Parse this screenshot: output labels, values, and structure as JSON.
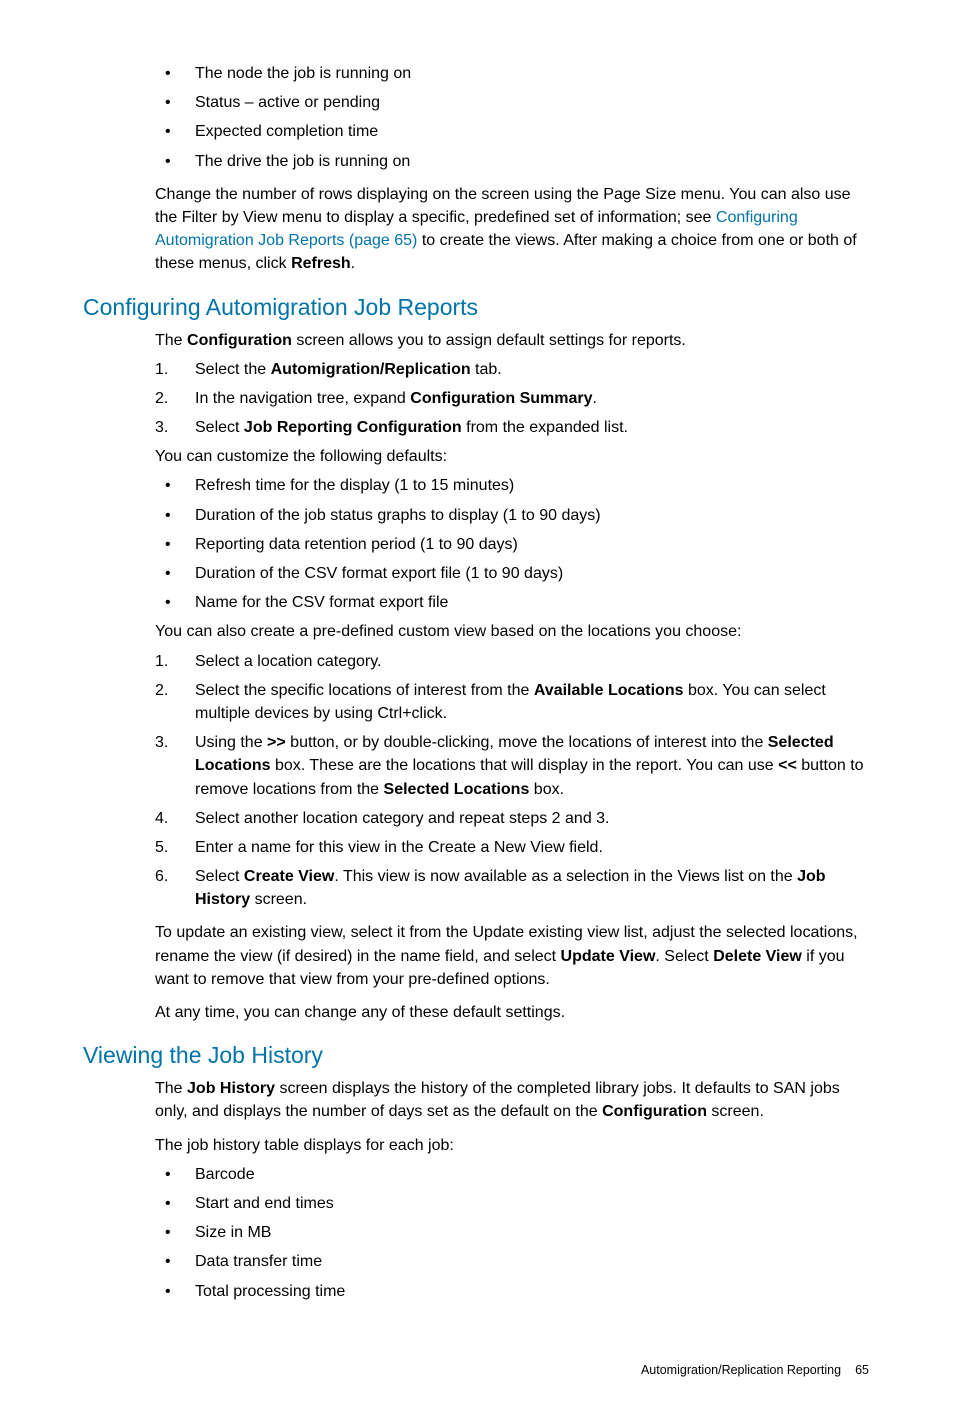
{
  "top_bullets": [
    "The node the job is running on",
    "Status – active or pending",
    "Expected completion time",
    "The drive the job is running on"
  ],
  "top_para": {
    "pre": "Change the number of rows displaying on the screen using the Page Size menu. You can also use the Filter by View menu to display a specific, predefined set of information; see ",
    "link": "Configuring Automigration Job Reports (page 65)",
    "post": " to create the views. After making a choice from one or both of these menus, click ",
    "bold_refresh": "Refresh",
    "period": "."
  },
  "sec1": {
    "heading": "Configuring Automigration Job Reports",
    "intro_pre": "The ",
    "intro_bold": "Configuration",
    "intro_post": " screen allows you to assign default settings for reports.",
    "steps1": {
      "s1_pre": "Select the ",
      "s1_bold": "Automigration/Replication",
      "s1_post": " tab.",
      "s2_pre": "In the navigation tree, expand ",
      "s2_bold": "Configuration Summary",
      "s2_post": ".",
      "s3_pre": "Select ",
      "s3_bold": "Job Reporting Configuration",
      "s3_post": " from the expanded list."
    },
    "customize_intro": "You can customize the following defaults:",
    "customize_bullets": [
      "Refresh time for the display (1 to 15 minutes)",
      "Duration of the job status graphs to display (1 to 90 days)",
      "Reporting data retention period (1 to 90 days)",
      "Duration of the CSV format export file (1 to 90 days)",
      "Name for the CSV format export file"
    ],
    "predefined_intro": "You can also create a pre-defined custom view based on the locations you choose:",
    "steps2": {
      "s1": "Select a location category.",
      "s2_pre": "Select the specific locations of interest from the ",
      "s2_bold": "Available Locations",
      "s2_post": " box. You can select multiple devices by using Ctrl+click.",
      "s3_pre": "Using the ",
      "s3_bold1": ">>",
      "s3_mid1": " button, or by double-clicking, move the locations of interest into the ",
      "s3_bold2": "Selected Locations",
      "s3_mid2": " box. These are the locations that will display in the report. You can use ",
      "s3_bold3": "<<",
      "s3_mid3": " button to remove locations from the ",
      "s3_bold4": "Selected Locations",
      "s3_post": " box.",
      "s4": "Select another location category and repeat steps 2 and 3.",
      "s5": "Enter a name for this view in the Create a New View field.",
      "s6_pre": "Select ",
      "s6_bold1": "Create View",
      "s6_mid": ". This view is now available as a selection in the Views list on the ",
      "s6_bold2": "Job History",
      "s6_post": " screen."
    },
    "update_para_pre": "To update an existing view, select it from the Update existing view list, adjust the selected locations, rename the view (if desired) in the name field, and select ",
    "update_bold1": "Update View",
    "update_mid": ". Select ",
    "update_bold2": "Delete View",
    "update_post": " if you want to remove that view from your pre-defined options.",
    "anytime": "At any time, you can change any of these default settings."
  },
  "sec2": {
    "heading": "Viewing the Job History",
    "intro_pre": "The ",
    "intro_bold1": "Job History",
    "intro_mid": " screen displays the history of the completed library jobs. It defaults to SAN jobs only, and displays the number of days set as the default on the ",
    "intro_bold2": "Configuration",
    "intro_post": " screen.",
    "table_intro": "The job history table displays for each job:",
    "bullets": [
      "Barcode",
      "Start and end times",
      "Size in MB",
      "Data transfer time",
      "Total processing time"
    ]
  },
  "footer": {
    "section": "Automigration/Replication Reporting",
    "page": "65"
  }
}
